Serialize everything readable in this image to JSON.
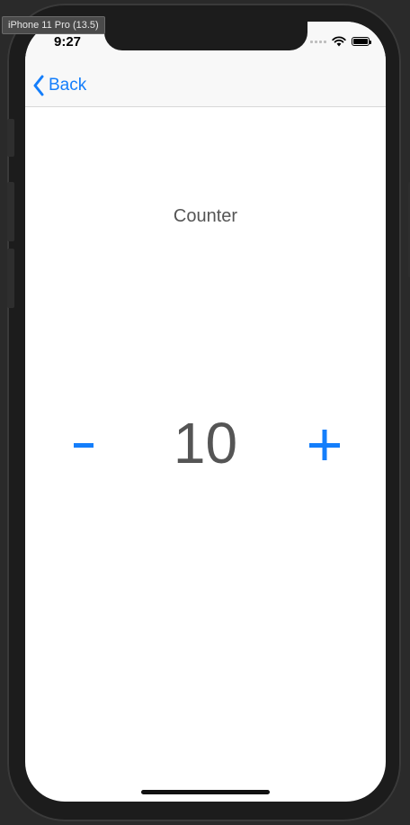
{
  "simulator": {
    "device_label": "iPhone 11 Pro (13.5)"
  },
  "status_bar": {
    "time": "9:27"
  },
  "nav": {
    "back_label": "Back"
  },
  "main": {
    "title": "Counter",
    "count": "10"
  },
  "icons": {
    "back": "chevron-left-icon",
    "minus": "minus-icon",
    "plus": "plus-icon",
    "wifi": "wifi-icon",
    "battery": "battery-icon",
    "signal": "signal-icon"
  },
  "colors": {
    "accent": "#147efb",
    "text": "#555555"
  }
}
